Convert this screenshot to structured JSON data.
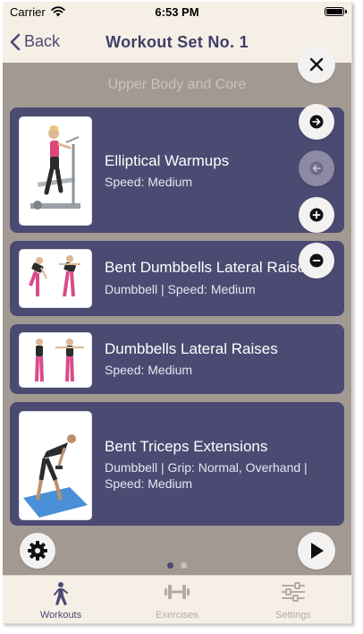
{
  "status_bar": {
    "carrier": "Carrier",
    "time": "6:53 PM"
  },
  "nav": {
    "back_label": "Back",
    "title": "Workout Set No. 1"
  },
  "section": {
    "heading": "Upper Body and Core"
  },
  "exercises": [
    {
      "name": "Elliptical Warmups",
      "detail": "Speed: Medium"
    },
    {
      "name": "Bent Dumbbells Lateral Raises",
      "detail": "Dumbbell | Speed: Medium"
    },
    {
      "name": "Dumbbells Lateral Raises",
      "detail": "Speed: Medium"
    },
    {
      "name": "Bent Triceps Extensions",
      "detail": "Dumbbell | Grip: Normal, Overhand |",
      "detail2": "Speed: Medium"
    }
  ],
  "pager": {
    "pages": 2,
    "current": 1
  },
  "tabs": [
    {
      "label": "Workouts",
      "icon": "person-walking-icon",
      "active": true
    },
    {
      "label": "Exercises",
      "icon": "dumbbell-icon",
      "active": false
    },
    {
      "label": "Settings",
      "icon": "sliders-icon",
      "active": false
    }
  ],
  "colors": {
    "accent": "#4b4a72",
    "overlay": "#a29a92",
    "background": "#f6efe6"
  }
}
